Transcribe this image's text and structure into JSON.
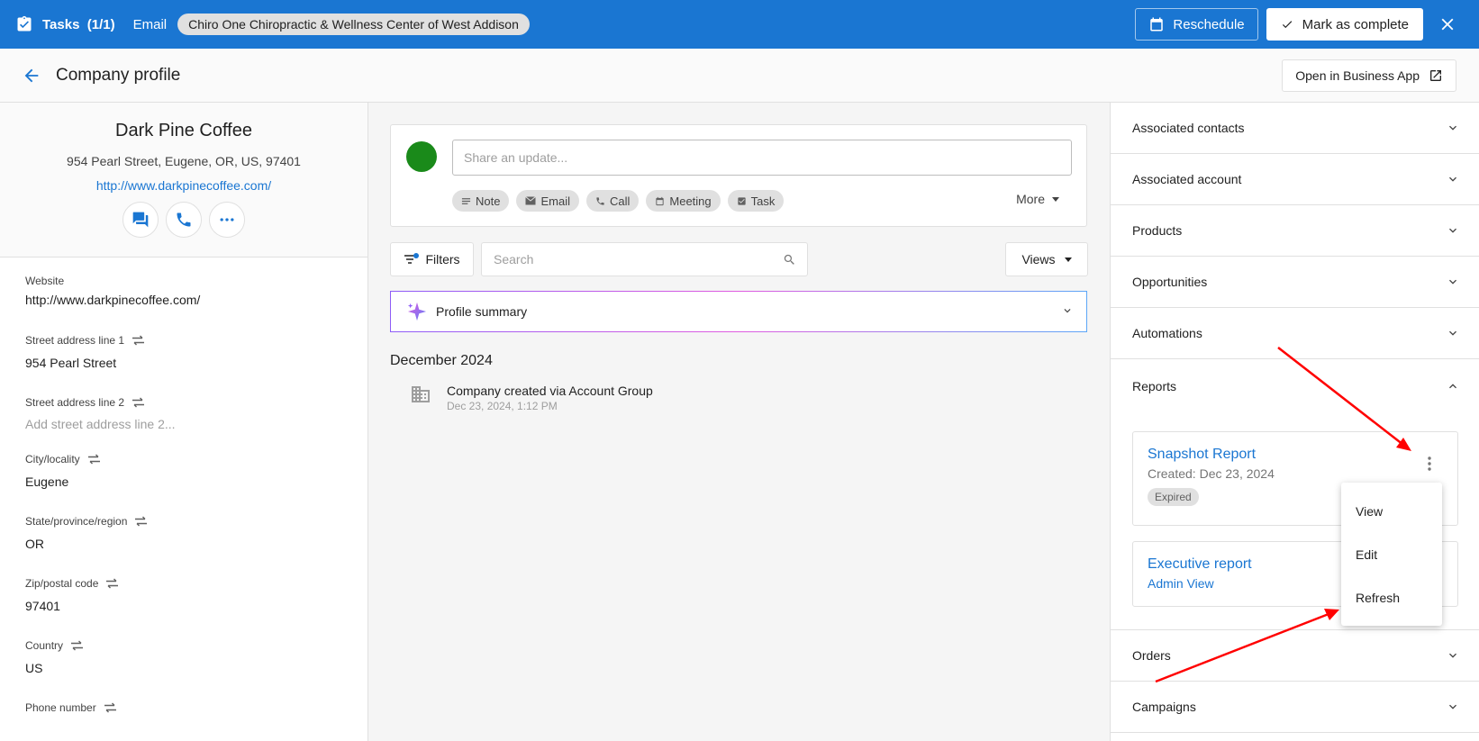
{
  "topbar": {
    "tasks_label": "Tasks",
    "tasks_count": "(1/1)",
    "email_label": "Email",
    "company_chip": "Chiro One Chiropractic & Wellness Center of West Addison",
    "reschedule_label": "Reschedule",
    "complete_label": "Mark as complete"
  },
  "header": {
    "title": "Company profile",
    "open_business_app": "Open in Business App"
  },
  "profile": {
    "name": "Dark Pine Coffee",
    "address": "954 Pearl Street, Eugene, OR, US, 97401",
    "url": "http://www.darkpinecoffee.com/"
  },
  "fields": [
    {
      "label": "Website",
      "value": "http://www.darkpinecoffee.com/"
    },
    {
      "label": "Street address line 1",
      "value": "954 Pearl Street"
    },
    {
      "label": "Street address line 2",
      "value": "Add street address line 2..."
    },
    {
      "label": "City/locality",
      "value": "Eugene"
    },
    {
      "label": "State/province/region",
      "value": "OR"
    },
    {
      "label": "Zip/postal code",
      "value": "97401"
    },
    {
      "label": "Country",
      "value": "US"
    },
    {
      "label": "Phone number",
      "value": ""
    }
  ],
  "composer": {
    "placeholder": "Share an update...",
    "chips": [
      "Note",
      "Email",
      "Call",
      "Meeting",
      "Task"
    ],
    "more_label": "More"
  },
  "feed": {
    "filters_label": "Filters",
    "search_placeholder": "Search",
    "views_label": "Views",
    "profile_summary_label": "Profile summary",
    "month": "December 2024",
    "entries": [
      {
        "title": "Company created via Account Group",
        "date": "Dec 23, 2024, 1:12 PM"
      }
    ]
  },
  "sidebar": {
    "sections": [
      "Associated contacts",
      "Associated account",
      "Products",
      "Opportunities",
      "Automations",
      "Reports",
      "Orders",
      "Campaigns"
    ],
    "reports": [
      {
        "title": "Snapshot Report",
        "subtitle": "Created: Dec 23, 2024",
        "badge": "Expired"
      },
      {
        "title": "Executive report",
        "link": "Admin View"
      }
    ],
    "menu": [
      "View",
      "Edit",
      "Refresh"
    ]
  },
  "colors": {
    "brand_blue": "#1a76d2",
    "avatar_green": "#1a8a1a",
    "annotation_red": "#ff0000"
  }
}
